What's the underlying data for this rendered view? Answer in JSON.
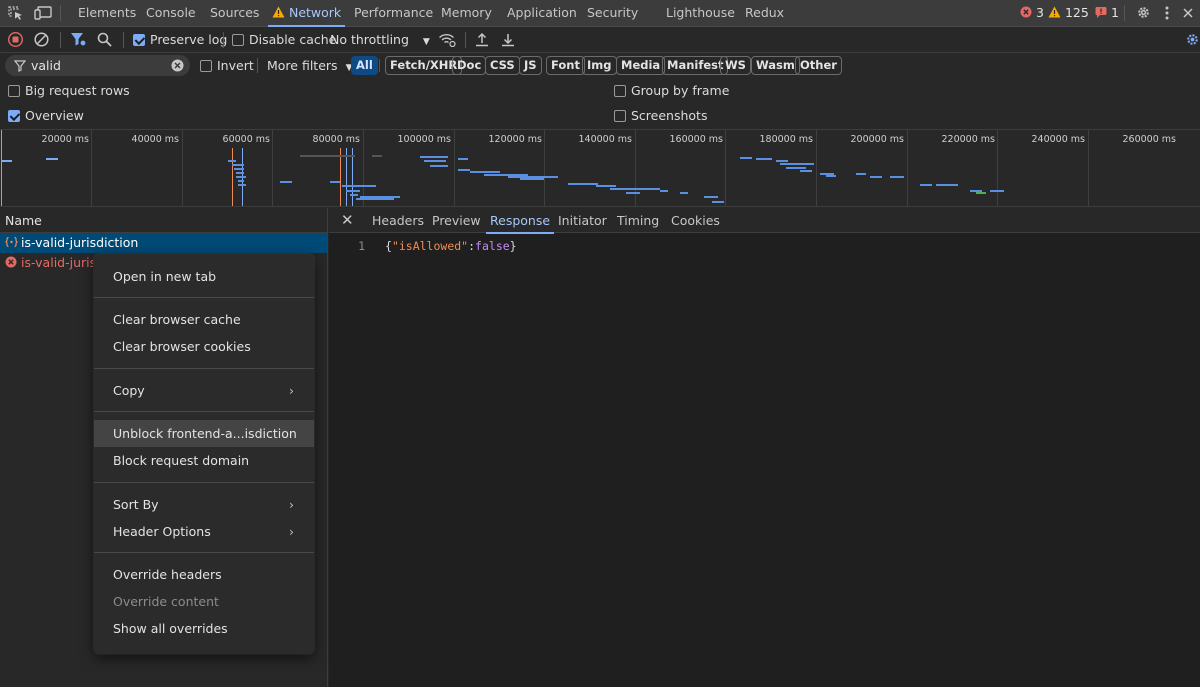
{
  "panel_tabs": [
    "Elements",
    "Console",
    "Sources",
    "Network",
    "Performance",
    "Memory",
    "Application",
    "Security",
    "Lighthouse",
    "Redux"
  ],
  "status": {
    "errors": "3",
    "warnings": "125",
    "issues": "1"
  },
  "toolbar": {
    "preserve_log": "Preserve log",
    "disable_cache": "Disable cache",
    "throttling": "No throttling"
  },
  "filter": {
    "value": "valid",
    "invert": "Invert",
    "more_filters": "More filters",
    "types": [
      "All",
      "Fetch/XHR",
      "Doc",
      "CSS",
      "JS",
      "Font",
      "Img",
      "Media",
      "Manifest",
      "WS",
      "Wasm",
      "Other"
    ]
  },
  "options": {
    "big_request_rows": "Big request rows",
    "overview": "Overview",
    "group_by_frame": "Group by frame",
    "screenshots": "Screenshots"
  },
  "timeline_ticks": [
    "20000 ms",
    "40000 ms",
    "60000 ms",
    "80000 ms",
    "100000 ms",
    "120000 ms",
    "140000 ms",
    "160000 ms",
    "180000 ms",
    "200000 ms",
    "220000 ms",
    "240000 ms",
    "260000 ms"
  ],
  "request_list": {
    "header": "Name",
    "rows": [
      {
        "name": "is-valid-jurisdiction",
        "status": "ok",
        "selected": true
      },
      {
        "name": "is-valid-jurisdi",
        "status": "error",
        "selected": false
      }
    ]
  },
  "detail_tabs": [
    "Headers",
    "Preview",
    "Response",
    "Initiator",
    "Timing",
    "Cookies"
  ],
  "response": {
    "line_number": "1",
    "open": "{",
    "key": "\"isAllowed\"",
    "colon": ":",
    "value": "false",
    "close": "}"
  },
  "context_menu": {
    "open_new_tab": "Open in new tab",
    "clear_cache": "Clear browser cache",
    "clear_cookies": "Clear browser cookies",
    "copy": "Copy",
    "unblock": "Unblock frontend-a...isdiction",
    "block_domain": "Block request domain",
    "sort_by": "Sort By",
    "header_options": "Header Options",
    "override_headers": "Override headers",
    "override_content": "Override content",
    "show_overrides": "Show all overrides"
  },
  "colors": {
    "accent": "#7cacf8",
    "selected_row": "#004a77",
    "error": "#e46962",
    "warning": "#f9ab00"
  }
}
